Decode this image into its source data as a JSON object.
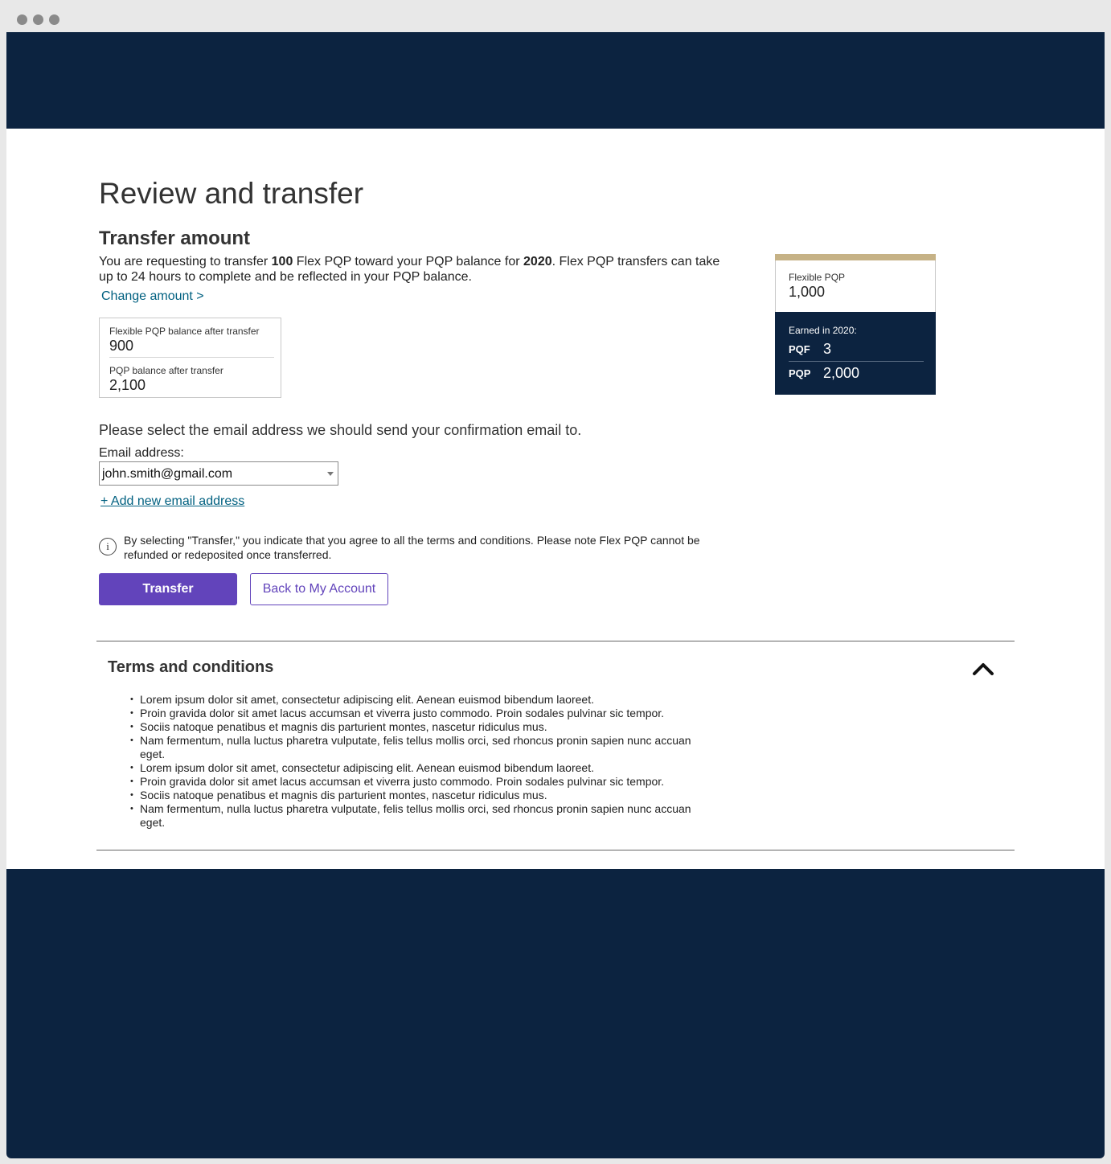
{
  "page": {
    "title": "Review and transfer",
    "section_title": "Transfer amount",
    "intro": {
      "p1": "You are requesting to transfer ",
      "amount": "100",
      "p2": " Flex PQP toward your PQP balance for ",
      "year": "2020",
      "p3": ". Flex PQP transfers can take up to 24 hours to complete and be reflected in your PQP balance."
    },
    "change_amount_link": "Change amount >"
  },
  "balance_box": {
    "flex_label": "Flexible PQP balance after transfer",
    "flex_value": "900",
    "pqp_label": "PQP balance after transfer",
    "pqp_value": "2,100"
  },
  "summary_card": {
    "flex_label": "Flexible PQP",
    "flex_value": "1,000",
    "earned_label": "Earned in 2020:",
    "pqf_key": "PQF",
    "pqf_value": "3",
    "pqp_key": "PQP",
    "pqp_value": "2,000"
  },
  "email": {
    "prompt": "Please select the email address we should send your confirmation email to.",
    "label": "Email address:",
    "selected": "john.smith@gmail.com",
    "add_link": "+ Add new email address"
  },
  "notice": {
    "icon": "info-icon",
    "text": "By selecting \"Transfer,\" you indicate that you agree to all the terms and conditions. Please note Flex PQP cannot be refunded or redeposited once transferred."
  },
  "buttons": {
    "transfer": "Transfer",
    "back": "Back to My Account"
  },
  "terms": {
    "title": "Terms and conditions",
    "toggle_icon": "chevron-up-icon",
    "items": [
      "Lorem ipsum dolor sit amet, consectetur adipiscing elit. Aenean euismod bibendum laoreet.",
      "Proin gravida dolor sit amet lacus accumsan et viverra justo commodo. Proin sodales pulvinar sic tempor.",
      "Sociis natoque penatibus et magnis dis parturient montes, nascetur ridiculus mus.",
      "Nam fermentum, nulla luctus pharetra vulputate, felis tellus mollis orci, sed rhoncus pronin sapien nunc accuan eget.",
      "Lorem ipsum dolor sit amet, consectetur adipiscing elit. Aenean euismod bibendum laoreet.",
      "Proin gravida dolor sit amet lacus accumsan et viverra justo commodo. Proin sodales pulvinar sic tempor.",
      "Sociis natoque penatibus et magnis dis parturient montes, nascetur ridiculus mus.",
      "Nam fermentum, nulla luctus pharetra vulputate, felis tellus mollis orci, sed rhoncus pronin sapien nunc accuan eget."
    ]
  },
  "colors": {
    "navy": "#0c2340",
    "purple": "#6244bb",
    "gold": "#c6b286",
    "link": "#006080"
  }
}
